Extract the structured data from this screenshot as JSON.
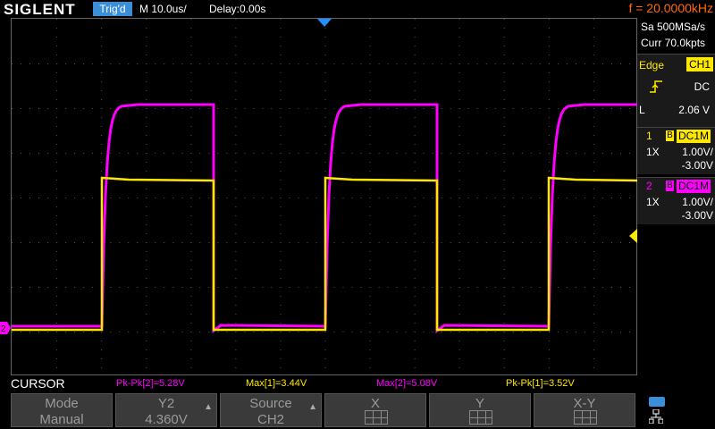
{
  "header": {
    "brand": "SIGLENT",
    "trigger_status": "Trig'd",
    "timebase": "M 10.0us/",
    "delay": "Delay:0.00s",
    "frequency": "f = 20.0000kHz"
  },
  "acquisition": {
    "sample_rate": "Sa 500MSa/s",
    "memory_depth": "Curr 70.0kpts"
  },
  "trigger": {
    "type": "Edge",
    "source": "CH1",
    "slope_icon": "rising-edge-icon",
    "coupling": "DC",
    "level_label": "L",
    "level": "2.06 V"
  },
  "channels": [
    {
      "number": "1",
      "bw": "B",
      "coupling": "DC1M",
      "probe": "1X",
      "scale": "1.00V/",
      "offset": "-3.00V",
      "color": "#ffe800"
    },
    {
      "number": "2",
      "bw": "B",
      "coupling": "DC1M",
      "probe": "1X",
      "scale": "1.00V/",
      "offset": "-3.00V",
      "color": "#ff00ff"
    }
  ],
  "channel_markers": {
    "ch2_ground": "2"
  },
  "measurements": {
    "mode_label": "CURSOR",
    "items": [
      {
        "text": "Pk-Pk[2]=5.28V",
        "color": "#ff00ff"
      },
      {
        "text": "Max[1]=3.44V",
        "color": "#ffe800"
      },
      {
        "text": "Max[2]=5.08V",
        "color": "#ff00ff"
      },
      {
        "text": "Pk-Pk[1]=3.52V",
        "color": "#ffe800"
      }
    ]
  },
  "softkeys": {
    "mode": {
      "title": "Mode",
      "value": "Manual"
    },
    "y2": {
      "title": "Y2",
      "value": "4.360V"
    },
    "source": {
      "title": "Source",
      "value": "CH2"
    },
    "x": {
      "title": "X"
    },
    "y": {
      "title": "Y"
    },
    "xy": {
      "title": "X-Y"
    }
  },
  "colors": {
    "ch1": "#ffe800",
    "ch2": "#ff00ff",
    "accent_blue": "#3a8fd6",
    "frequency_orange": "#ff6a00"
  }
}
